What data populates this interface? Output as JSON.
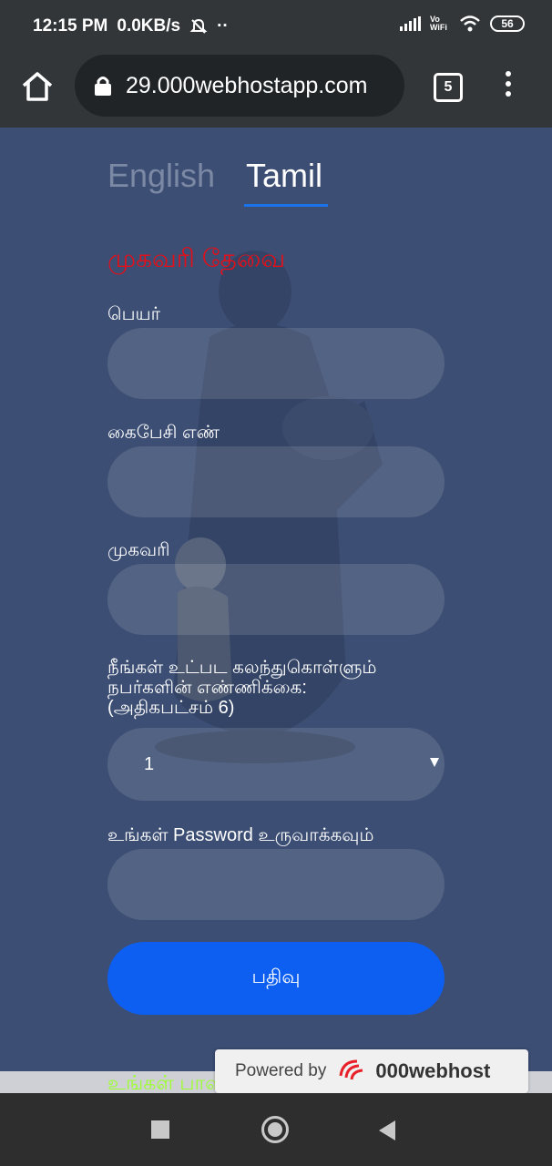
{
  "status_bar": {
    "time": "12:15 PM",
    "speed": "0.0KB/s",
    "mute_icon": "mute-icon",
    "dots": "··",
    "volte": "Vo WiFi",
    "battery": "56"
  },
  "browser": {
    "url": "29.000webhostapp.com",
    "tab_count": "5"
  },
  "language_tabs": {
    "english": "English",
    "tamil": "Tamil",
    "selected": "Tamil"
  },
  "form": {
    "heading": "முகவரி தேவை",
    "name_label": "பெயர்",
    "name_value": "",
    "phone_label": "கைபேசி எண்",
    "phone_value": "",
    "address_label": "முகவரி",
    "address_value": "",
    "count_label_line1": "நீங்கள் உட்பட கலந்துகொள்ளும்",
    "count_label_line2": "நபர்களின் எண்ணிக்கை:",
    "count_label_line3": "(அதிகபட்சம் 6)",
    "count_value": "1",
    "password_label": "உங்கள் Password உருவாக்கவும்",
    "password_value": "",
    "submit_label": "பதிவு"
  },
  "footer": {
    "green_text": "உங்கள் பாஸ்வேர்ட் தேவை",
    "powered_by": "Powered by",
    "brand": "000webhost"
  },
  "colors": {
    "page_bg": "#3c4e74",
    "heading_red": "#e3101a",
    "submit_blue": "#0d5ff2",
    "tab_underline": "#1a73e8",
    "green_text": "#9cff2e"
  }
}
